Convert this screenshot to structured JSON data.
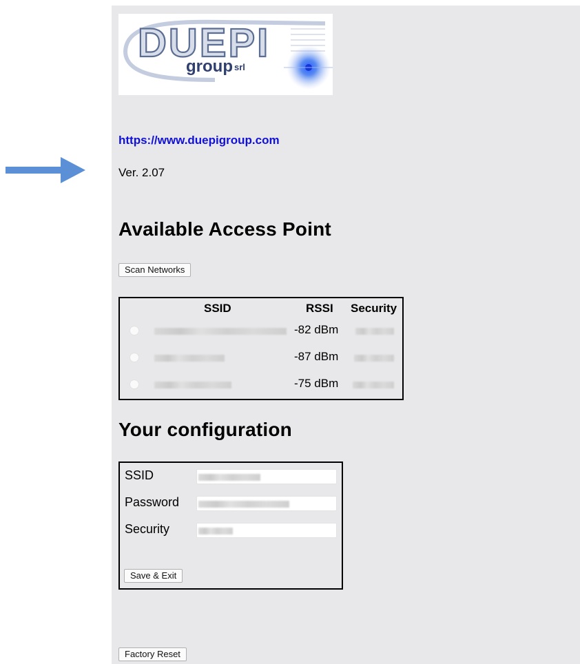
{
  "header": {
    "logo": {
      "name": "DUEPI",
      "sub": "group",
      "suffix": "srl"
    },
    "link": "https://www.duepigroup.com",
    "version": "Ver. 2.07"
  },
  "access_points": {
    "title": "Available Access Point",
    "scan_label": "Scan Networks",
    "columns": [
      "SSID",
      "RSSI",
      "Security"
    ],
    "rows": [
      {
        "ssid": "",
        "rssi": "-82 dBm",
        "security": ""
      },
      {
        "ssid": "",
        "rssi": "-87 dBm",
        "security": ""
      },
      {
        "ssid": "",
        "rssi": "-75 dBm",
        "security": ""
      }
    ]
  },
  "configuration": {
    "title": "Your configuration",
    "fields": [
      {
        "label": "SSID",
        "value": ""
      },
      {
        "label": "Password",
        "value": ""
      },
      {
        "label": "Security",
        "value": ""
      }
    ],
    "save_label": "Save & Exit"
  },
  "footer": {
    "factory_reset_label": "Factory Reset"
  },
  "colors": {
    "panel_bg": "#e8e8ea",
    "link": "#1010d8",
    "arrow": "#5b8fd6"
  }
}
